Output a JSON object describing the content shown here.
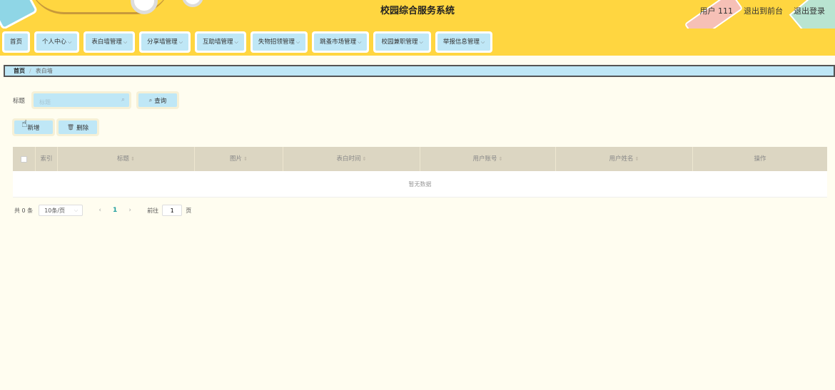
{
  "header": {
    "title": "校园综合服务系统",
    "user": "用户 111",
    "back_front": "退出到前台",
    "logout": "退出登录"
  },
  "nav": {
    "items": [
      {
        "label": "首页",
        "dropdown": false
      },
      {
        "label": "个人中心",
        "dropdown": true
      },
      {
        "label": "表白墙管理",
        "dropdown": true
      },
      {
        "label": "分享墙管理",
        "dropdown": true
      },
      {
        "label": "互助墙管理",
        "dropdown": true
      },
      {
        "label": "失物招领管理",
        "dropdown": true
      },
      {
        "label": "跳蚤市场管理",
        "dropdown": true
      },
      {
        "label": "校园兼职管理",
        "dropdown": true
      },
      {
        "label": "举报信息管理",
        "dropdown": true
      }
    ]
  },
  "breadcrumb": {
    "home": "首页",
    "separator": "/",
    "current": "表白墙"
  },
  "search": {
    "label": "标题",
    "placeholder": "标题",
    "value": "",
    "query_button": "查询"
  },
  "actions": {
    "add": "新增",
    "delete": "删除"
  },
  "table": {
    "columns": [
      "索引",
      "标题",
      "图片",
      "表白时间",
      "用户账号",
      "用户姓名",
      "操作"
    ],
    "empty_text": "暂无数据"
  },
  "pagination": {
    "total": "共 0 条",
    "page_size": "10条/页",
    "current_page": "1",
    "goto_label": "前往",
    "goto_value": "1",
    "page_suffix": "页"
  },
  "icons": {
    "search_field": "search-icon",
    "query": "search-icon",
    "add": "hand-cursor-icon",
    "delete": "trash-icon"
  },
  "colors": {
    "header_bg": "#ffd640",
    "button_bg": "#bfe7f6",
    "page_bg": "#fffdf0",
    "table_header_bg": "#dcd6c2",
    "accent": "#1f9e9e"
  }
}
